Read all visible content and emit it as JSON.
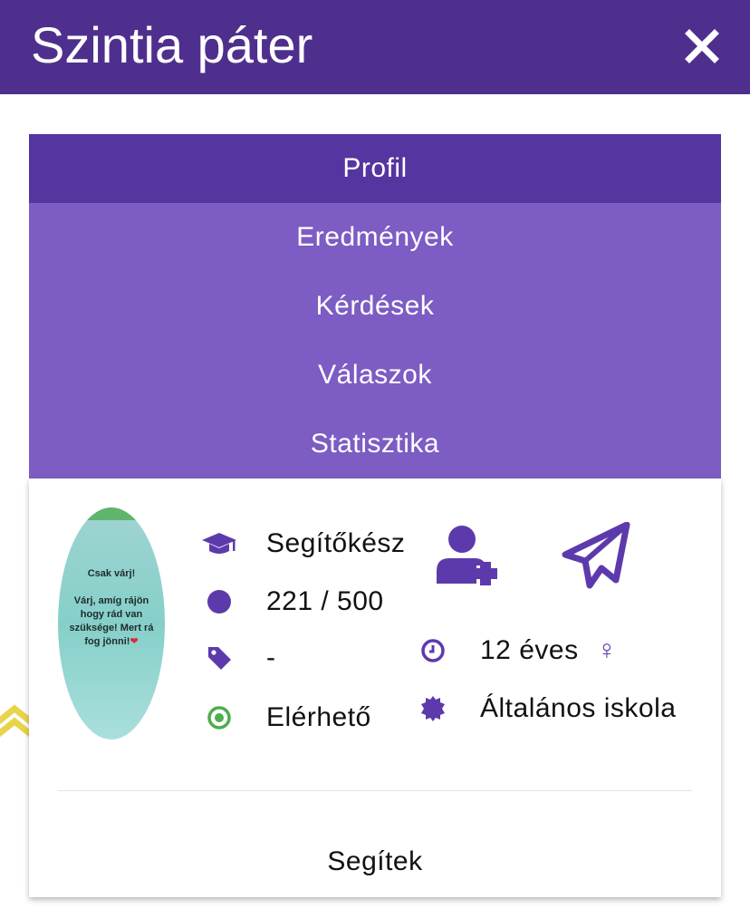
{
  "header": {
    "title": "Szintia páter"
  },
  "tabs": [
    {
      "label": "Profil"
    },
    {
      "label": "Eredmények"
    },
    {
      "label": "Kérdések"
    },
    {
      "label": "Válaszok"
    },
    {
      "label": "Statisztika"
    }
  ],
  "profile": {
    "avatar_text": "Csak várj!\n\nVárj, amíg rájön hogy rád van szüksége! Mert rá fog jönni!",
    "rank": "Segítőkész",
    "points": "221 / 500",
    "tag": "-",
    "status": "Elérhető",
    "age": "12 éves",
    "gender_symbol": "♀",
    "school": "Általános iskola"
  },
  "footer": {
    "help_label": "Segítek"
  },
  "icons": {
    "close": "close-icon",
    "rank": "graduation-cap-icon",
    "points": "circle-icon",
    "tag": "tag-icon",
    "status": "dot-circle-icon",
    "add_friend": "user-plus-icon",
    "message": "paper-plane-icon",
    "age": "clock-icon",
    "gender": "venus-icon",
    "school": "certificate-icon"
  },
  "colors": {
    "header_bg": "#4e2f8e",
    "tab_active": "#5535a0",
    "tab_inactive": "#7d5cc3",
    "icon_purple": "#5d3aac",
    "status_green": "#4cae4c"
  }
}
